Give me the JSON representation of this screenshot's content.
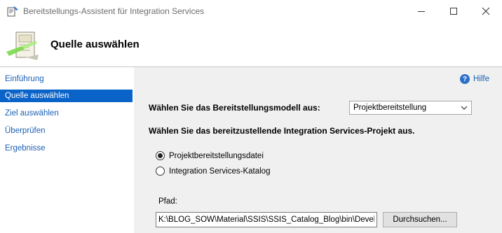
{
  "window": {
    "title": "Bereitstellungs-Assistent für Integration Services"
  },
  "header": {
    "title": "Quelle auswählen"
  },
  "nav": {
    "items": [
      {
        "label": "Einführung",
        "selected": false
      },
      {
        "label": "Quelle auswählen",
        "selected": true
      },
      {
        "label": "Ziel auswählen",
        "selected": false
      },
      {
        "label": "Überprüfen",
        "selected": false
      },
      {
        "label": "Ergebnisse",
        "selected": false
      }
    ]
  },
  "main": {
    "help_label": "Hilfe",
    "model_label": "Wählen Sie das Bereitstellungsmodell aus:",
    "model_selected": "Projektbereitstellung",
    "project_label": "Wählen Sie das bereitzustellende Integration Services-Projekt aus.",
    "radio_options": [
      {
        "label": "Projektbereitstellungsdatei",
        "checked": true
      },
      {
        "label": "Integration Services-Katalog",
        "checked": false
      }
    ],
    "path_label": "Pfad:",
    "path_value": "K:\\BLOG_SOW\\Material\\SSIS\\SSIS_Catalog_Blog\\bin\\Developm",
    "browse_label": "Durchsuchen..."
  },
  "colors": {
    "accent": "#0a63c9",
    "link": "#1a5fb4",
    "content_bg": "#f0f0f0"
  }
}
